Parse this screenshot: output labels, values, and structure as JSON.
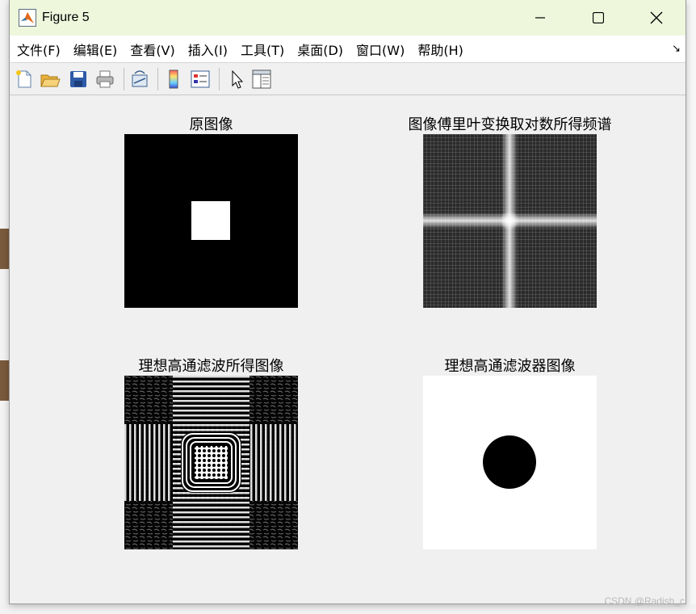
{
  "window": {
    "title": "Figure 5"
  },
  "menu": [
    "文件(F)",
    "编辑(E)",
    "查看(V)",
    "插入(I)",
    "工具(T)",
    "桌面(D)",
    "窗口(W)",
    "帮助(H)"
  ],
  "toolbar": [
    "new-figure",
    "open-file",
    "save",
    "print",
    "link-plot",
    "insert-colorbar",
    "insert-legend",
    "edit-plot",
    "property-inspector"
  ],
  "subplots": [
    {
      "title": "原图像"
    },
    {
      "title": "图像傅里叶变换取对数所得频谱"
    },
    {
      "title": "理想高通滤波所得图像"
    },
    {
      "title": "理想高通滤波器图像"
    }
  ],
  "watermark": "CSDN @Radish_c",
  "colors": {
    "titlebar": "#eef6dc",
    "figure_bg": "#f0f0f0"
  }
}
